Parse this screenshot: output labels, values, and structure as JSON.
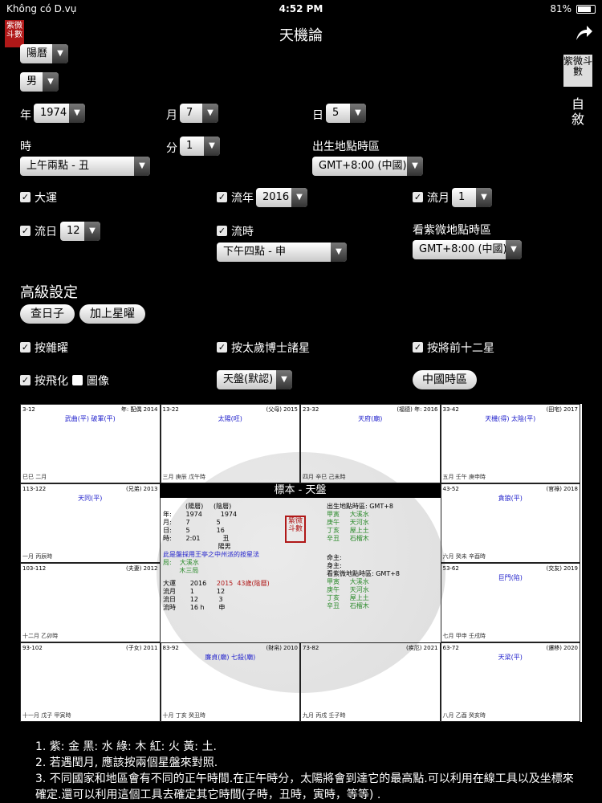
{
  "status": {
    "carrier": "Không có D.vụ",
    "time": "4:52 PM",
    "battery": "81%",
    "battery_level": 0.81
  },
  "nav": {
    "title": "天機論",
    "logo": "紫微斗數"
  },
  "side": {
    "logo": "紫微斗數",
    "text": "自敘"
  },
  "form": {
    "calendar": "陽曆",
    "gender": "男",
    "year_label": "年",
    "year": "1974",
    "month_label": "月",
    "month": "7",
    "day_label": "日",
    "day": "5",
    "hour_label": "時",
    "hour": "上午兩點 - 丑",
    "minute_label": "分",
    "minute": "1",
    "birth_tz_label": "出生地點時區",
    "birth_tz": "GMT+8:00 (中國)",
    "dayun_label": "大運",
    "liunian_label": "流年",
    "liunian": "2016",
    "liuyue_label": "流月",
    "liuyue": "1",
    "liuri_label": "流日",
    "liuri": "12",
    "liushi_label": "流時",
    "liushi": "下午四點 - 申",
    "view_tz_label": "看紫微地點時區",
    "view_tz": "GMT+8:00 (中國)"
  },
  "advanced": {
    "title": "高級設定",
    "btn_calendar": "查日子",
    "btn_addstar": "加上星曜",
    "opt_zaiyao": "按雜曜",
    "opt_suijian": "按太歲博士諸星",
    "opt_jiangqian": "按將前十二星",
    "opt_feihua": "按飛化",
    "opt_image": "圖像",
    "pan": "天盤(默認)",
    "china_time": "中國時區"
  },
  "chart": {
    "center_title": "標本 - 天盤",
    "cells": [
      {
        "range": "3-12",
        "palace": "年: 配偶 2014",
        "stars": "武曲(平) 破軍(平)",
        "pos": "巳巳 二月"
      },
      {
        "range": "13-22",
        "palace": "(父母) 2015",
        "stars": "太陽(旺)",
        "pos": "三月 庚辰 戊午時"
      },
      {
        "range": "23-32",
        "palace": "(福德) 年: 2016",
        "stars": "天府(廟)",
        "pos": "四月 辛巳 己未時"
      },
      {
        "range": "33-42",
        "palace": "(田宅) 2017",
        "stars": "天機(得) 太陰(平)",
        "pos": "五月 壬午 庚申時"
      },
      {
        "range": "113-122",
        "palace": "(兄弟) 2013",
        "stars": "天同(平)",
        "pos": "一月 丙辰時"
      },
      {
        "range": "43-52",
        "palace": "(官祿) 2018",
        "stars": "貪狼(平)",
        "pos": "六月 癸未 辛酉時"
      },
      {
        "range": "103-112",
        "palace": "(夫妻) 2012",
        "stars": "",
        "pos": "十二月 乙卯時"
      },
      {
        "range": "53-62",
        "palace": "(交友) 2019",
        "stars": "巨門(陷)",
        "pos": "七月 甲申 壬戌時"
      },
      {
        "range": "93-102",
        "palace": "(子女) 2011",
        "stars": "",
        "pos": "十一月 戊子 甲寅時"
      },
      {
        "range": "83-92",
        "palace": "(財帛) 2010",
        "stars": "廉貞(廟) 七殺(廟)",
        "pos": "十月 丁亥 癸丑時"
      },
      {
        "range": "73-82",
        "palace": "(疾厄) 2021",
        "stars": "",
        "pos": "九月 丙戌 壬子時"
      },
      {
        "range": "63-72",
        "palace": "(遷移) 2020",
        "stars": "天梁(平)",
        "pos": "八月 乙酉 癸亥時"
      }
    ],
    "center": {
      "solar_label": "(陽曆)",
      "lunar_label": "(陰曆)",
      "year": "1974",
      "month": "7",
      "day": "5",
      "lunar_month": "5",
      "lunar_day": "16",
      "hour": "2:01",
      "hour_zhi": "丑",
      "yin_yang": "陽男",
      "note": "此是盤採用王亭之中州派的按星法",
      "ju": "大溪水",
      "ju_type": "木三局",
      "dayun": "2016",
      "dayun_lunar": "2015",
      "dayun_range": "43歲(陰曆)",
      "liuyue": "1",
      "liuyue_lunar": "12",
      "liuri": "12",
      "liuri_lunar": "3",
      "liushi": "16 h",
      "liushi_zhi": "申",
      "tz_label": "出生地點時區: GMT+8",
      "view_tz_label": "看紫微地點時區: GMT+8",
      "ganzhi": [
        "甲寅",
        "庚午",
        "丁亥",
        "辛丑",
        "大溪水",
        "天河水",
        "屋上土",
        "石榴木"
      ],
      "minggong": "命主:",
      "shengong": "身主:"
    }
  },
  "notes": [
    "1.  紫: 金    黑: 水    綠: 木    紅: 火    黃: 土.",
    "2.  若遇閏月, 應該按兩個星盤來對照.",
    "3.  不同國家和地區會有不同的正午時間.在正午時分，太陽將會到達它的最高點.可以利用在線工具以及坐標來確定.還可以利用這個工具去確定其它時間(子時，丑時，寅時，等等) ."
  ]
}
